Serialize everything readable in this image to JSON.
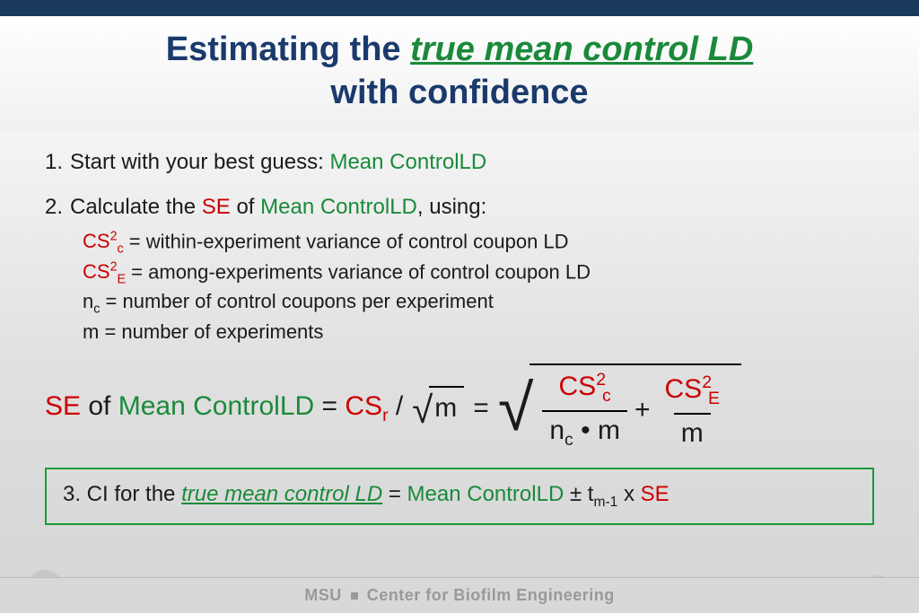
{
  "title": {
    "pre": "Estimating the ",
    "em": "true mean control LD",
    "post": " with confidence"
  },
  "step1": {
    "num": "1.",
    "lead": "Start with your best guess: ",
    "term": "Mean ControlLD"
  },
  "step2": {
    "num": "2.",
    "lead": "Calculate the ",
    "se": "SE",
    "mid": " of ",
    "term": "Mean ControlLD",
    "tail": ", using:"
  },
  "defs": {
    "cs2c_l": "CS",
    "cs2c_r": " = within-experiment variance of control coupon LD",
    "cs2e_l": "CS",
    "cs2e_r": " = among-experiments variance of control coupon LD",
    "nc_l": "n",
    "nc_r": " = number of control coupons per experiment",
    "m_l": "m",
    "m_r": "  = number of experiments",
    "sup2": "2",
    "subc": "c",
    "sube": "E"
  },
  "formula": {
    "se": "SE",
    "of": " of ",
    "term": "Mean ControlLD",
    "eq1": " = ",
    "csr": "CS",
    "subr": "r",
    "slash": " /",
    "m": "m",
    "eq2": "  =  ",
    "cs": "CS",
    "sup2": "2",
    "subc": "c",
    "sube": "E",
    "nc": "n",
    "dot": " • ",
    "plus": " + "
  },
  "step3": {
    "num": "3.",
    "lead": " CI for the ",
    "em": "true mean control LD",
    "eq": " = ",
    "term": "Mean ControlLD",
    "pm": " ± t",
    "sub": "m-1",
    "x": " x ",
    "se": "SE"
  },
  "footer": {
    "left": "MSU",
    "right": "Center for Biofilm Engineering"
  }
}
